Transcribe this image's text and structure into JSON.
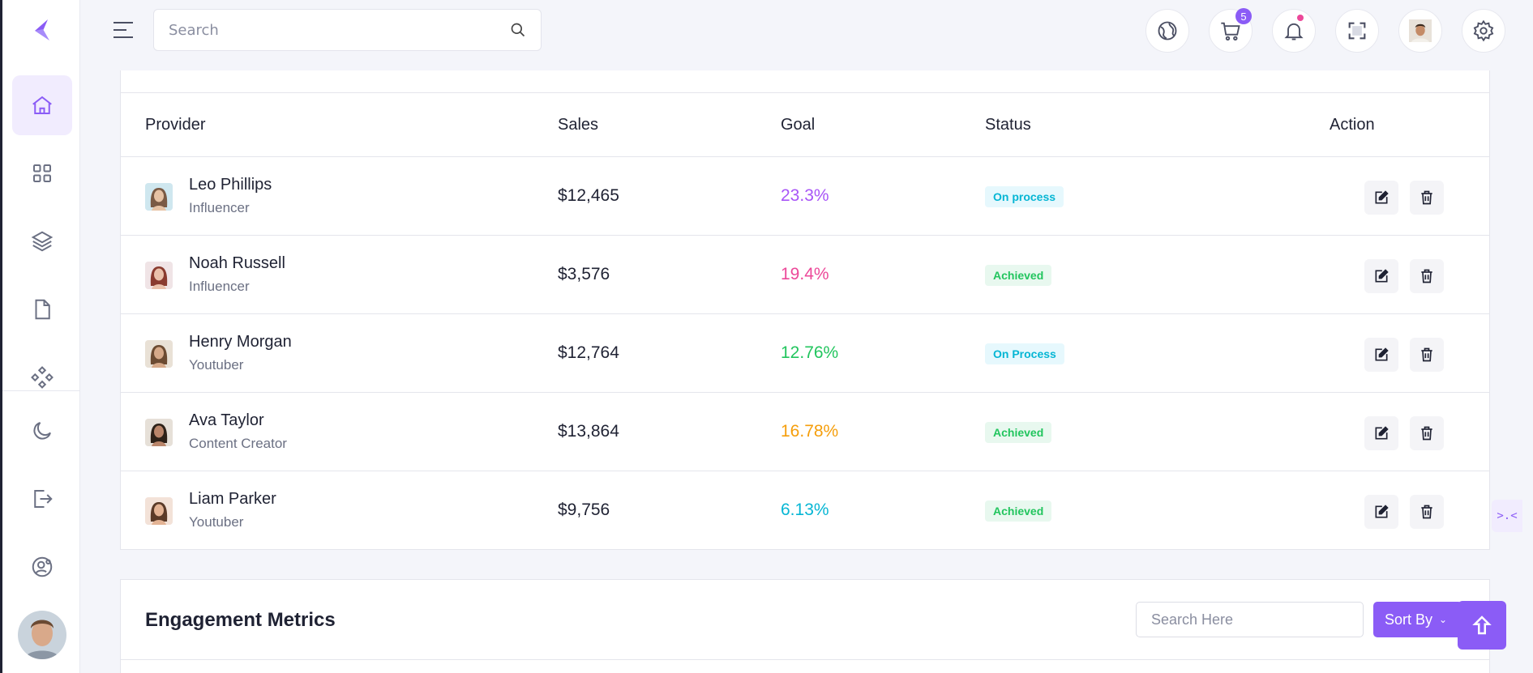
{
  "header": {
    "search_placeholder": "Search",
    "cart_count": "5"
  },
  "table": {
    "columns": [
      "Provider",
      "Sales",
      "Goal",
      "Status",
      "Action"
    ],
    "rows": [
      {
        "name": "Leo Phillips",
        "role": "Influencer",
        "sales": "$12,465",
        "goal": "23.3%",
        "goal_color": "#a855f7",
        "status": "On process",
        "status_type": "process"
      },
      {
        "name": "Noah Russell",
        "role": "Influencer",
        "sales": "$3,576",
        "goal": "19.4%",
        "goal_color": "#ec4899",
        "status": "Achieved",
        "status_type": "achieved"
      },
      {
        "name": "Henry Morgan",
        "role": "Youtuber",
        "sales": "$12,764",
        "goal": "12.76%",
        "goal_color": "#22c55e",
        "status": "On Process",
        "status_type": "process"
      },
      {
        "name": "Ava Taylor",
        "role": "Content Creator",
        "sales": "$13,864",
        "goal": "16.78%",
        "goal_color": "#f59e0b",
        "status": "Achieved",
        "status_type": "achieved"
      },
      {
        "name": "Liam Parker",
        "role": "Youtuber",
        "sales": "$9,756",
        "goal": "6.13%",
        "goal_color": "#06b6d4",
        "status": "Achieved",
        "status_type": "achieved"
      }
    ]
  },
  "engagement": {
    "title": "Engagement Metrics",
    "search_placeholder": "Search Here",
    "sort_label": "Sort By"
  },
  "colors": {
    "accent": "#8b5cf6",
    "process_text": "#06b6d4",
    "achieved_text": "#22c55e"
  }
}
